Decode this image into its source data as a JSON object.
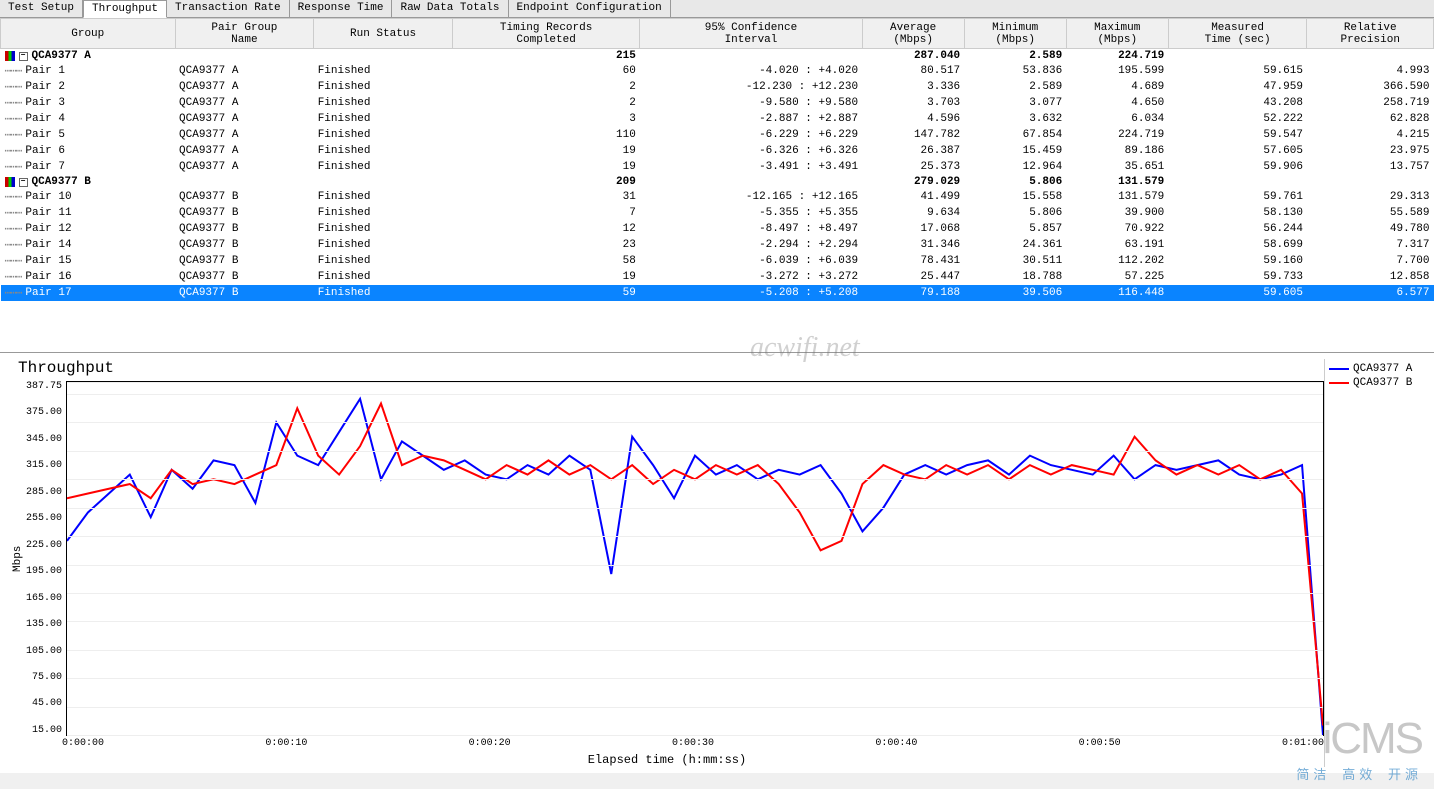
{
  "tabs": [
    "Test Setup",
    "Throughput",
    "Transaction Rate",
    "Response Time",
    "Raw Data Totals",
    "Endpoint Configuration"
  ],
  "active_tab": 1,
  "columns": [
    "Group",
    "Pair Group\nName",
    "Run Status",
    "Timing Records\nCompleted",
    "95% Confidence\nInterval",
    "Average\n(Mbps)",
    "Minimum\n(Mbps)",
    "Maximum\n(Mbps)",
    "Measured\nTime (sec)",
    "Relative\nPrecision"
  ],
  "groups": [
    {
      "name": "QCA9377 A",
      "summary": {
        "timing": "215",
        "avg": "287.040",
        "min": "2.589",
        "max": "224.719"
      },
      "rows": [
        {
          "pair": "Pair 1",
          "pg": "QCA9377 A",
          "status": "Finished",
          "timing": "60",
          "conf": "-4.020 :  +4.020",
          "avg": "80.517",
          "min": "53.836",
          "max": "195.599",
          "time": "59.615",
          "prec": "4.993"
        },
        {
          "pair": "Pair 2",
          "pg": "QCA9377 A",
          "status": "Finished",
          "timing": "2",
          "conf": "-12.230 : +12.230",
          "avg": "3.336",
          "min": "2.589",
          "max": "4.689",
          "time": "47.959",
          "prec": "366.590"
        },
        {
          "pair": "Pair 3",
          "pg": "QCA9377 A",
          "status": "Finished",
          "timing": "2",
          "conf": "-9.580 :  +9.580",
          "avg": "3.703",
          "min": "3.077",
          "max": "4.650",
          "time": "43.208",
          "prec": "258.719"
        },
        {
          "pair": "Pair 4",
          "pg": "QCA9377 A",
          "status": "Finished",
          "timing": "3",
          "conf": "-2.887 :  +2.887",
          "avg": "4.596",
          "min": "3.632",
          "max": "6.034",
          "time": "52.222",
          "prec": "62.828"
        },
        {
          "pair": "Pair 5",
          "pg": "QCA9377 A",
          "status": "Finished",
          "timing": "110",
          "conf": "-6.229 :  +6.229",
          "avg": "147.782",
          "min": "67.854",
          "max": "224.719",
          "time": "59.547",
          "prec": "4.215"
        },
        {
          "pair": "Pair 6",
          "pg": "QCA9377 A",
          "status": "Finished",
          "timing": "19",
          "conf": "-6.326 :  +6.326",
          "avg": "26.387",
          "min": "15.459",
          "max": "89.186",
          "time": "57.605",
          "prec": "23.975"
        },
        {
          "pair": "Pair 7",
          "pg": "QCA9377 A",
          "status": "Finished",
          "timing": "19",
          "conf": "-3.491 :  +3.491",
          "avg": "25.373",
          "min": "12.964",
          "max": "35.651",
          "time": "59.906",
          "prec": "13.757"
        }
      ]
    },
    {
      "name": "QCA9377 B",
      "summary": {
        "timing": "209",
        "avg": "279.029",
        "min": "5.806",
        "max": "131.579"
      },
      "rows": [
        {
          "pair": "Pair 10",
          "pg": "QCA9377 B",
          "status": "Finished",
          "timing": "31",
          "conf": "-12.165 : +12.165",
          "avg": "41.499",
          "min": "15.558",
          "max": "131.579",
          "time": "59.761",
          "prec": "29.313"
        },
        {
          "pair": "Pair 11",
          "pg": "QCA9377 B",
          "status": "Finished",
          "timing": "7",
          "conf": "-5.355 :  +5.355",
          "avg": "9.634",
          "min": "5.806",
          "max": "39.900",
          "time": "58.130",
          "prec": "55.589"
        },
        {
          "pair": "Pair 12",
          "pg": "QCA9377 B",
          "status": "Finished",
          "timing": "12",
          "conf": "-8.497 :  +8.497",
          "avg": "17.068",
          "min": "5.857",
          "max": "70.922",
          "time": "56.244",
          "prec": "49.780"
        },
        {
          "pair": "Pair 14",
          "pg": "QCA9377 B",
          "status": "Finished",
          "timing": "23",
          "conf": "-2.294 :  +2.294",
          "avg": "31.346",
          "min": "24.361",
          "max": "63.191",
          "time": "58.699",
          "prec": "7.317"
        },
        {
          "pair": "Pair 15",
          "pg": "QCA9377 B",
          "status": "Finished",
          "timing": "58",
          "conf": "-6.039 :  +6.039",
          "avg": "78.431",
          "min": "30.511",
          "max": "112.202",
          "time": "59.160",
          "prec": "7.700"
        },
        {
          "pair": "Pair 16",
          "pg": "QCA9377 B",
          "status": "Finished",
          "timing": "19",
          "conf": "-3.272 :  +3.272",
          "avg": "25.447",
          "min": "18.788",
          "max": "57.225",
          "time": "59.733",
          "prec": "12.858"
        },
        {
          "pair": "Pair 17",
          "pg": "QCA9377 B",
          "status": "Finished",
          "timing": "59",
          "conf": "-5.208 :  +5.208",
          "avg": "79.188",
          "min": "39.506",
          "max": "116.448",
          "time": "59.605",
          "prec": "6.577",
          "selected": true
        }
      ]
    }
  ],
  "watermark": "acwifi.net",
  "icms": {
    "big": "iCMS",
    "sub": "简洁 高效 开源"
  },
  "chart_data": {
    "type": "line",
    "title": "Throughput",
    "xlabel": "Elapsed time (h:mm:ss)",
    "ylabel": "Mbps",
    "ylim": [
      15,
      387.75
    ],
    "yticks": [
      "387.75",
      "375.00",
      "345.00",
      "315.00",
      "285.00",
      "255.00",
      "225.00",
      "195.00",
      "165.00",
      "135.00",
      "105.00",
      "75.00",
      "45.00",
      "15.00"
    ],
    "xticks": [
      "0:00:00",
      "0:00:10",
      "0:00:20",
      "0:00:30",
      "0:00:40",
      "0:00:50",
      "0:01:00"
    ],
    "legend": [
      {
        "name": "QCA9377 A",
        "color": "#0000ff"
      },
      {
        "name": "QCA9377 B",
        "color": "#ff0000"
      }
    ],
    "series": [
      {
        "name": "QCA9377 A",
        "color": "#0000ff",
        "values": [
          220,
          250,
          270,
          290,
          245,
          295,
          275,
          305,
          300,
          260,
          345,
          310,
          300,
          335,
          370,
          285,
          325,
          310,
          295,
          305,
          290,
          285,
          300,
          290,
          310,
          295,
          185,
          330,
          300,
          265,
          310,
          290,
          300,
          285,
          295,
          290,
          300,
          270,
          230,
          255,
          290,
          300,
          290,
          300,
          305,
          290,
          310,
          300,
          295,
          290,
          310,
          285,
          300,
          295,
          300,
          305,
          290,
          285,
          290,
          300,
          15
        ]
      },
      {
        "name": "QCA9377 B",
        "color": "#ff0000",
        "values": [
          265,
          270,
          275,
          280,
          265,
          295,
          280,
          285,
          280,
          290,
          300,
          360,
          310,
          290,
          320,
          365,
          300,
          310,
          305,
          295,
          285,
          300,
          290,
          305,
          290,
          300,
          285,
          300,
          280,
          295,
          285,
          300,
          290,
          300,
          280,
          250,
          210,
          220,
          280,
          300,
          290,
          285,
          300,
          290,
          300,
          285,
          300,
          290,
          300,
          295,
          290,
          330,
          305,
          290,
          300,
          290,
          300,
          285,
          295,
          270,
          25
        ]
      }
    ]
  }
}
